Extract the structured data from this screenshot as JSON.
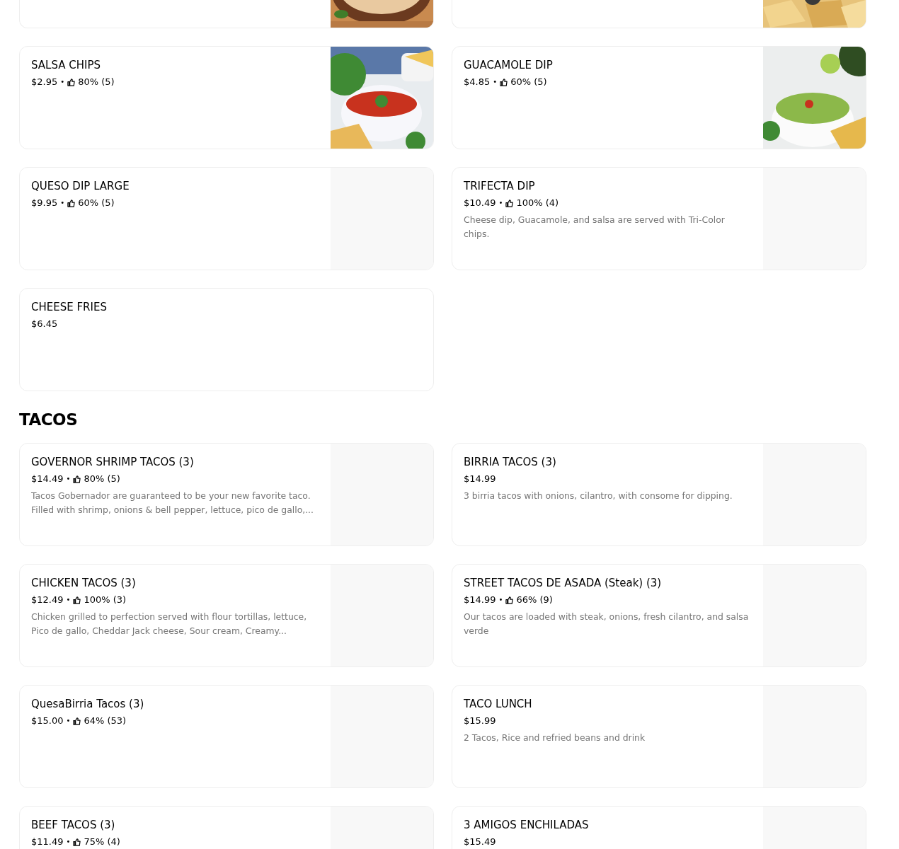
{
  "sections": [
    {
      "items": [
        {
          "partial": true,
          "has_photo": true
        },
        {
          "partial": true,
          "has_photo": true
        },
        {
          "name": "SALSA CHIPS",
          "price": "$2.95",
          "separator": "•",
          "rating": "80% (5)",
          "has_photo": true
        },
        {
          "name": "GUACAMOLE DIP",
          "price": "$4.85",
          "separator": "•",
          "rating": "60% (5)",
          "has_photo": true
        },
        {
          "name": "QUESO DIP LARGE",
          "price": "$9.95",
          "separator": "•",
          "rating": "60% (5)",
          "has_photo": false
        },
        {
          "name": "TRIFECTA DIP",
          "price": "$10.49",
          "separator": "•",
          "rating": "100% (4)",
          "description": "Cheese dip, Guacamole, and salsa are served with Tri-Color chips.",
          "has_photo": false
        },
        {
          "name": "CHEESE FRIES",
          "price": "$6.45"
        }
      ]
    },
    {
      "title": "TACOS",
      "items": [
        {
          "name": "GOVERNOR SHRIMP TACOS (3)",
          "price": "$14.49",
          "separator": "•",
          "rating": "80% (5)",
          "description": "Tacos Gobernador are guaranteed to be your new favorite taco. Filled with shrimp, onions & bell pepper, lettuce, pico de gallo,...",
          "has_photo": false
        },
        {
          "name": "BIRRIA TACOS (3)",
          "price": "$14.99",
          "description": "3 birria tacos with onions, cilantro, with consome for dipping.",
          "has_photo": false
        },
        {
          "name": "CHICKEN TACOS (3)",
          "price": "$12.49",
          "separator": "•",
          "rating": "100% (3)",
          "description": "Chicken grilled to perfection served with flour tortillas, lettuce, Pico de gallo, Cheddar Jack cheese, Sour cream, Creamy...",
          "has_photo": false
        },
        {
          "name": "STREET TACOS DE ASADA  (Steak) (3)",
          "price": "$14.99",
          "separator": "•",
          "rating": "66% (9)",
          "description": "Our tacos are loaded with steak, onions, fresh cilantro, and salsa verde",
          "has_photo": false
        },
        {
          "name": "QuesaBirria Tacos (3)",
          "price": "$15.00",
          "separator": "•",
          "rating": "64% (53)",
          "has_photo": false
        },
        {
          "name": "TACO LUNCH",
          "price": "$15.99",
          "description": "2 Tacos, Rice and refried beans and drink",
          "has_photo": false
        },
        {
          "name": "BEEF TACOS (3)",
          "price": "$11.49",
          "separator": "•",
          "rating": "75% (4)",
          "has_photo": false
        },
        {
          "name": "3 AMIGOS ENCHILADAS",
          "price": "$15.49",
          "has_photo": false
        }
      ]
    }
  ]
}
